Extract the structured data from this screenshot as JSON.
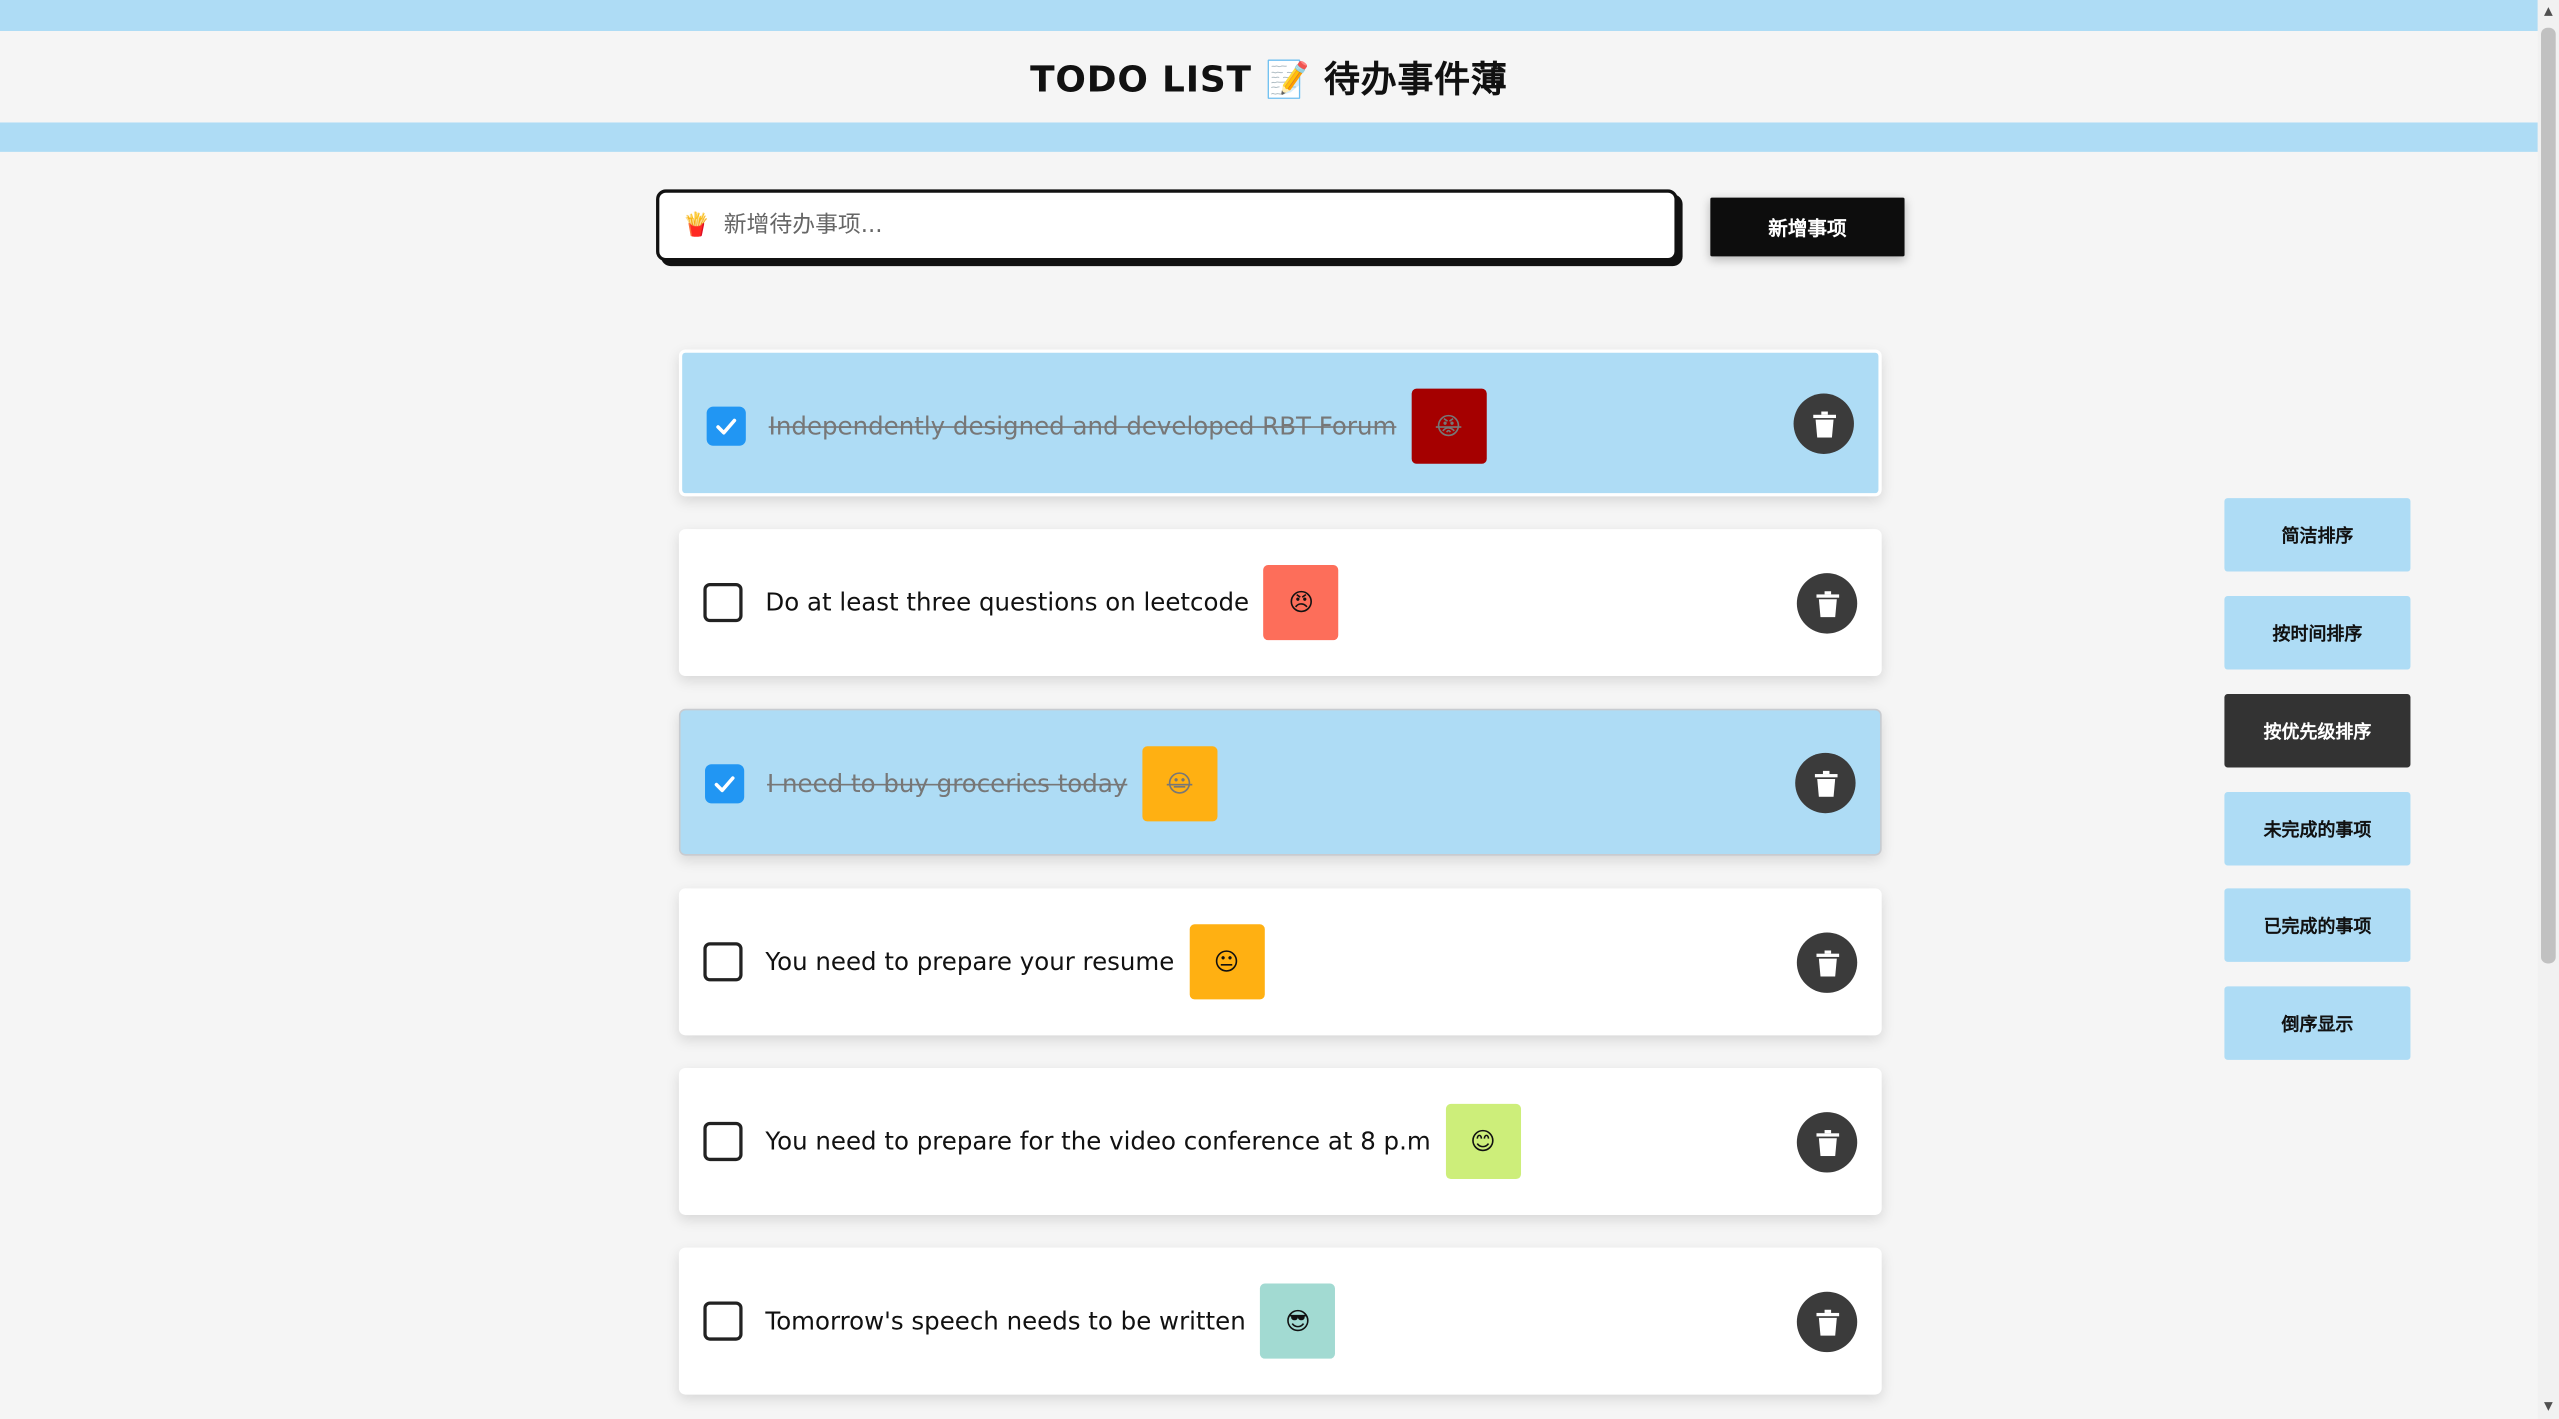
{
  "header": {
    "title": "TODO LIST 📝 待办事件薄"
  },
  "input": {
    "icon": "🍟",
    "placeholder": "新增待办事项...",
    "value": ""
  },
  "add_button": {
    "label": "新增事项"
  },
  "todos": [
    {
      "text": "Independently designed and developed RBT Forum",
      "done": true,
      "emoji": "😡",
      "color": "#a50000"
    },
    {
      "text": "Do at least three questions on leetcode",
      "done": false,
      "emoji": "😠",
      "color": "#fd6e5a"
    },
    {
      "text": "I need to buy groceries today",
      "done": true,
      "emoji": "😐",
      "color": "#ffb012"
    },
    {
      "text": "You need to prepare your resume",
      "done": false,
      "emoji": "😐",
      "color": "#ffb012"
    },
    {
      "text": "You need to prepare for the video conference at 8 p.m",
      "done": false,
      "emoji": "😊",
      "color": "#cdee7a"
    },
    {
      "text": "Tomorrow's speech needs to be written",
      "done": false,
      "emoji": "😎",
      "color": "#a2dad2"
    }
  ],
  "sidebar": {
    "buttons": [
      {
        "label": "简洁排序",
        "active": false
      },
      {
        "label": "按时间排序",
        "active": false
      },
      {
        "label": "按优先级排序",
        "active": true
      },
      {
        "label": "未完成的事项",
        "active": false
      },
      {
        "label": "已完成的事项",
        "active": false
      },
      {
        "label": "倒序显示",
        "active": false
      }
    ]
  },
  "colors": {
    "stripe": "#aedcf5",
    "checkbox_checked": "#2196f3",
    "trash_button": "#3b3b3b",
    "active_sort": "#333333"
  },
  "icons": {
    "checkbox": "check-icon",
    "delete": "trash-icon"
  }
}
